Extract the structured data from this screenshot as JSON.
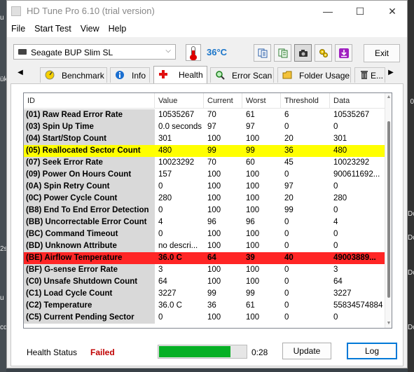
{
  "background": {
    "left_fragments": [
      "u Kaydet",
      "ük",
      "2s",
      "u",
      "cd"
    ],
    "right_fragments": [
      "0",
      "Dc",
      "Dc",
      "Dc",
      "Dc"
    ]
  },
  "window": {
    "title": "HD Tune Pro 6.10 (trial version)",
    "controls": {
      "minimize": "—",
      "maximize": "☐",
      "close": "✕"
    }
  },
  "menu": [
    "File",
    "Start Test",
    "View",
    "Help"
  ],
  "toolbar": {
    "drive": "Seagate BUP Slim SL",
    "temperature": "36°C",
    "temperature_color": "#1a75c9",
    "icons": [
      "copy-text-icon",
      "copy-info-icon",
      "screenshot-camera-icon",
      "options-gears-icon",
      "save-download-icon"
    ],
    "exit_label": "Exit"
  },
  "tabs": [
    {
      "label": "Benchmark",
      "icon": "gauge-icon"
    },
    {
      "label": "Info",
      "icon": "info-icon"
    },
    {
      "label": "Health",
      "icon": "red-cross-icon",
      "active": true
    },
    {
      "label": "Error Scan",
      "icon": "magnifier-icon"
    },
    {
      "label": "Folder Usage",
      "icon": "folder-icon"
    },
    {
      "label": "E...",
      "icon": "trash-icon"
    }
  ],
  "table": {
    "columns": [
      "ID",
      "Value",
      "Current",
      "Worst",
      "Threshold",
      "Data"
    ],
    "rows": [
      {
        "id": "(01) Raw Read Error Rate",
        "value": "10535267",
        "current": "70",
        "worst": "61",
        "threshold": "6",
        "data": "10535267",
        "status": "ok"
      },
      {
        "id": "(03) Spin Up Time",
        "value": "0.0 seconds",
        "current": "97",
        "worst": "97",
        "threshold": "0",
        "data": "0",
        "status": "ok"
      },
      {
        "id": "(04) Start/Stop Count",
        "value": "301",
        "current": "100",
        "worst": "100",
        "threshold": "20",
        "data": "301",
        "status": "ok"
      },
      {
        "id": "(05) Reallocated Sector Count",
        "value": "480",
        "current": "99",
        "worst": "99",
        "threshold": "36",
        "data": "480",
        "status": "warning"
      },
      {
        "id": "(07) Seek Error Rate",
        "value": "10023292",
        "current": "70",
        "worst": "60",
        "threshold": "45",
        "data": "10023292",
        "status": "ok"
      },
      {
        "id": "(09) Power On Hours Count",
        "value": "157",
        "current": "100",
        "worst": "100",
        "threshold": "0",
        "data": "900611692...",
        "status": "ok"
      },
      {
        "id": "(0A) Spin Retry Count",
        "value": "0",
        "current": "100",
        "worst": "100",
        "threshold": "97",
        "data": "0",
        "status": "ok"
      },
      {
        "id": "(0C) Power Cycle Count",
        "value": "280",
        "current": "100",
        "worst": "100",
        "threshold": "20",
        "data": "280",
        "status": "ok"
      },
      {
        "id": "(B8) End To End Error Detection",
        "value": "0",
        "current": "100",
        "worst": "100",
        "threshold": "99",
        "data": "0",
        "status": "ok"
      },
      {
        "id": "(BB) Uncorrectable Error Count",
        "value": "4",
        "current": "96",
        "worst": "96",
        "threshold": "0",
        "data": "4",
        "status": "ok"
      },
      {
        "id": "(BC) Command Timeout",
        "value": "0",
        "current": "100",
        "worst": "100",
        "threshold": "0",
        "data": "0",
        "status": "ok"
      },
      {
        "id": "(BD) Unknown Attribute",
        "value": "no descri...",
        "current": "100",
        "worst": "100",
        "threshold": "0",
        "data": "0",
        "status": "ok"
      },
      {
        "id": "(BE) Airflow Temperature",
        "value": "36.0 C",
        "current": "64",
        "worst": "39",
        "threshold": "40",
        "data": "49003889...",
        "status": "failed"
      },
      {
        "id": "(BF) G-sense Error Rate",
        "value": "3",
        "current": "100",
        "worst": "100",
        "threshold": "0",
        "data": "3",
        "status": "ok"
      },
      {
        "id": "(C0) Unsafe Shutdown Count",
        "value": "64",
        "current": "100",
        "worst": "100",
        "threshold": "0",
        "data": "64",
        "status": "ok"
      },
      {
        "id": "(C1) Load Cycle Count",
        "value": "3227",
        "current": "99",
        "worst": "99",
        "threshold": "0",
        "data": "3227",
        "status": "ok"
      },
      {
        "id": "(C2) Temperature",
        "value": "36.0 C",
        "current": "36",
        "worst": "61",
        "threshold": "0",
        "data": "55834574884",
        "status": "ok"
      },
      {
        "id": "(C5) Current Pending Sector",
        "value": "0",
        "current": "100",
        "worst": "100",
        "threshold": "0",
        "data": "0",
        "status": "ok"
      }
    ],
    "colors": {
      "warning": "#ffff00",
      "failed": "#ff2525"
    }
  },
  "footer": {
    "health_status_label": "Health Status",
    "health_status_value": "Failed",
    "health_status_color": "#c00000",
    "progress_fraction": 0.82,
    "progress_time": "0:28",
    "update_label": "Update",
    "log_label": "Log"
  }
}
